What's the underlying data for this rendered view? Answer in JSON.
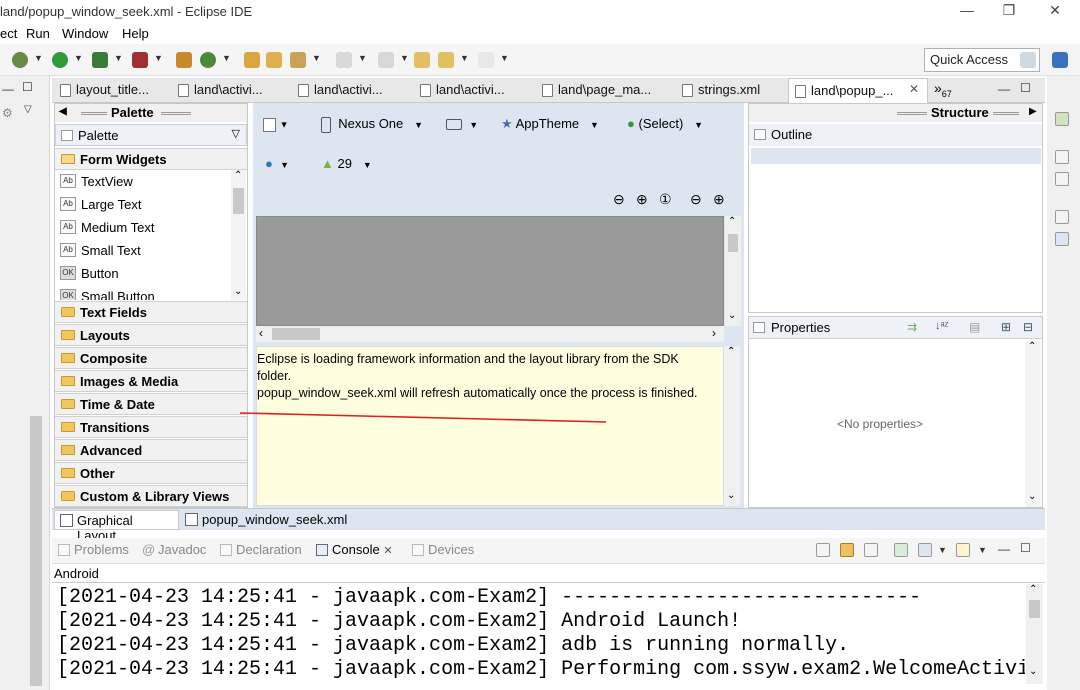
{
  "window": {
    "title": "land/popup_window_seek.xml - Eclipse IDE",
    "minimize": "—",
    "restore": "❐",
    "close": "✕"
  },
  "menu": [
    "ect",
    "Run",
    "Window",
    "Help"
  ],
  "toolbar": {
    "quick_access": "Quick Access"
  },
  "editor_tabs": [
    {
      "label": "layout_title..."
    },
    {
      "label": "land\\activi..."
    },
    {
      "label": "land\\activi..."
    },
    {
      "label": "land\\activi..."
    },
    {
      "label": "land\\page_ma..."
    },
    {
      "label": "strings.xml"
    },
    {
      "label": "land\\popup_..."
    }
  ],
  "overflow_tabs": "67",
  "palette": {
    "header": "Palette",
    "dropdown": "Palette",
    "form_widgets": "Form Widgets",
    "widgets": [
      {
        "icon": "Ab",
        "label": "TextView"
      },
      {
        "icon": "Ab",
        "label": "Large Text"
      },
      {
        "icon": "Ab",
        "label": "Medium Text"
      },
      {
        "icon": "Ab",
        "label": "Small Text"
      },
      {
        "icon": "OK",
        "label": "Button"
      },
      {
        "icon": "OK",
        "label": "Small Button"
      }
    ],
    "sections": [
      "Text Fields",
      "Layouts",
      "Composite",
      "Images & Media",
      "Time & Date",
      "Transitions",
      "Advanced",
      "Other",
      "Custom & Library Views"
    ]
  },
  "designer": {
    "device": "Nexus One",
    "theme": "AppTheme",
    "activity": "(Select)",
    "api": "29",
    "message_line1": "Eclipse is loading framework information and the layout library from the SDK",
    "message_line2": "folder.",
    "message_line3": "popup_window_seek.xml will refresh automatically once the process is finished."
  },
  "structure": {
    "header": "Structure",
    "outline": "Outline",
    "properties": "Properties",
    "no_properties": "<No properties>"
  },
  "bottom_tabs": {
    "graphical": "Graphical Layout",
    "xml": "popup_window_seek.xml"
  },
  "console": {
    "tabs": [
      "Problems",
      "Javadoc",
      "Declaration",
      "Console",
      "Devices"
    ],
    "active": "Console",
    "label": "Android",
    "lines": [
      "[2021-04-23 14:25:41 - javaapk.com-Exam2] ------------------------------",
      "[2021-04-23 14:25:41 - javaapk.com-Exam2] Android Launch!",
      "[2021-04-23 14:25:41 - javaapk.com-Exam2] adb is running normally.",
      "[2021-04-23 14:25:41 - javaapk.com-Exam2] Performing com.ssyw.exam2.WelcomeActivi"
    ]
  },
  "colors": {
    "selection_bg": "#dde6f0",
    "message_bg": "#ffffe0",
    "annotation_line": "#e02020"
  }
}
